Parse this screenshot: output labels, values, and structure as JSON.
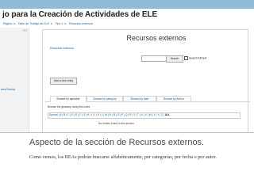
{
  "header": {
    "site_title": "jo para la Creación de Actividades de ELE"
  },
  "breadcrumb": {
    "items": [
      "Página",
      "Taller de Trabajo de ELE",
      "Tipo 1",
      "Recursos externos"
    ]
  },
  "sidebar": {
    "edit_label": "???",
    "link_text": "bres Escrita"
  },
  "glossary": {
    "title": "Recursos externos",
    "sub_link": "Recursos externos",
    "search_placeholder": "",
    "search_button": "Search",
    "fulltext_label": "Search full text",
    "add_entry_button": "Add a new entry",
    "tabs": [
      "Browse by alphabet",
      "Browse by category",
      "Browse by date",
      "Browse by Author"
    ],
    "browse_label": "Browse the glossary using this index",
    "letters_prefix": "Special | A | B | C | D | E | F | G | H | I | J | K | L | M | N | Ñ | O | P | Q | R | S | T | U | V | W | X | Y | Z |",
    "letters_all": "ALL",
    "no_entries": "No entries found in this section"
  },
  "caption": {
    "title": "Aspecto de la sección de Recursos externos.",
    "text": "Como vemos, los REAs podrán buscarse alfabéticamente, por categorías, por fecha o por autor."
  }
}
